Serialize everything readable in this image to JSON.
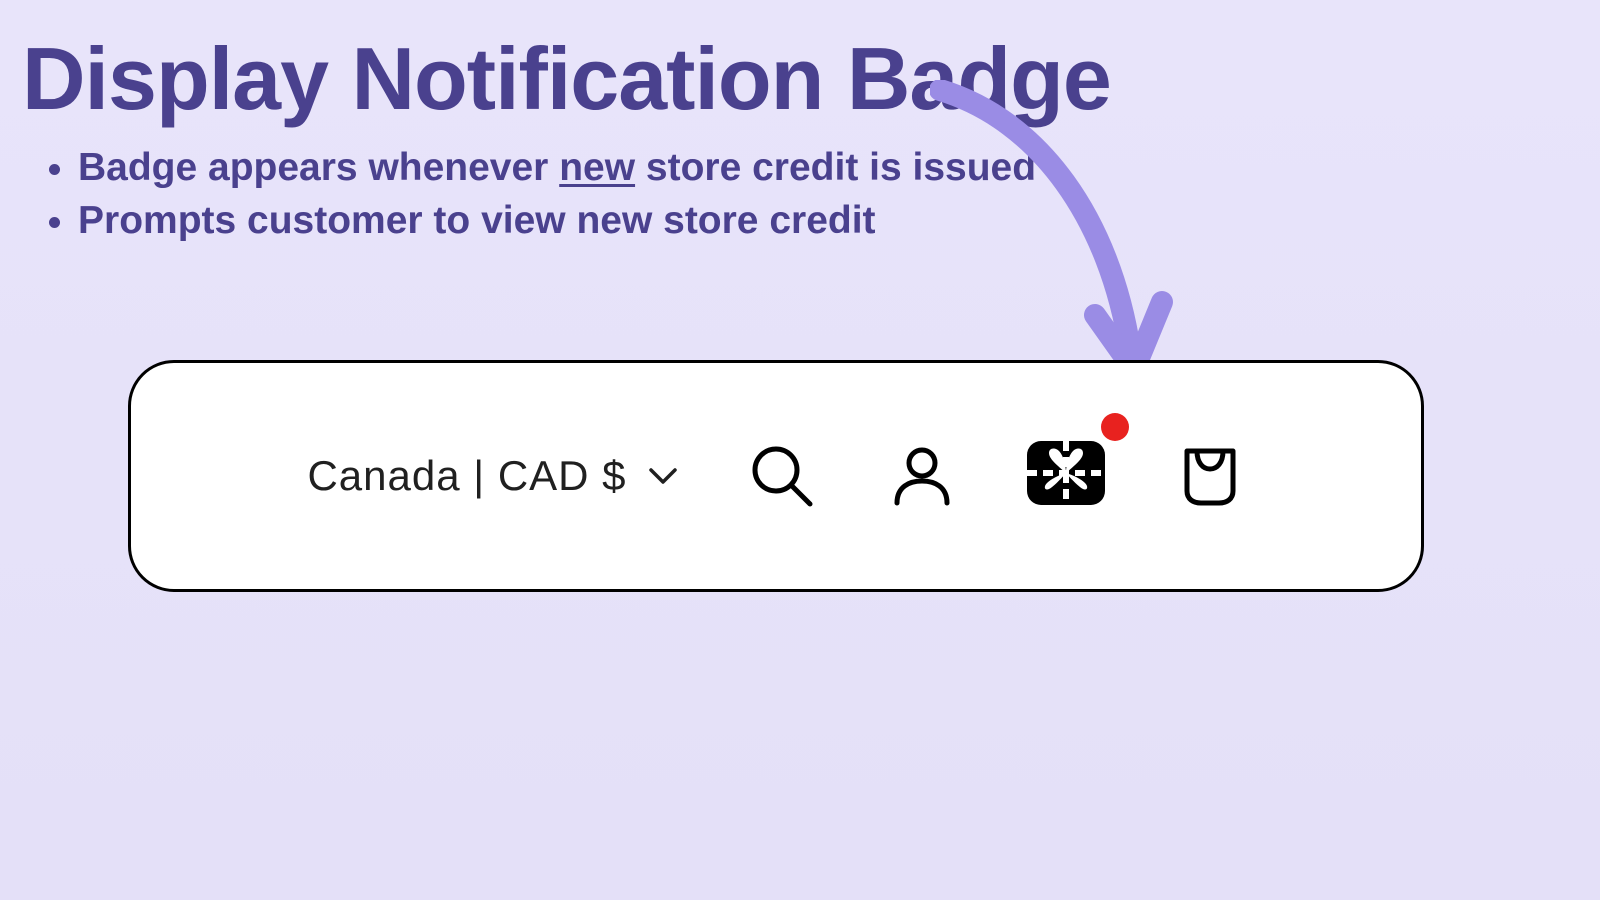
{
  "title": "Display Notification Badge",
  "bullets": {
    "item1_pre": "Badge appears whenever ",
    "item1_underline": "new",
    "item1_post": " store credit is issued",
    "item2": "Prompts customer to view new store credit"
  },
  "toolbar": {
    "locale_label": "Canada | CAD $"
  },
  "colors": {
    "heading": "#4A418E",
    "arrow": "#9A8CE5",
    "badge": "#E8221F"
  }
}
